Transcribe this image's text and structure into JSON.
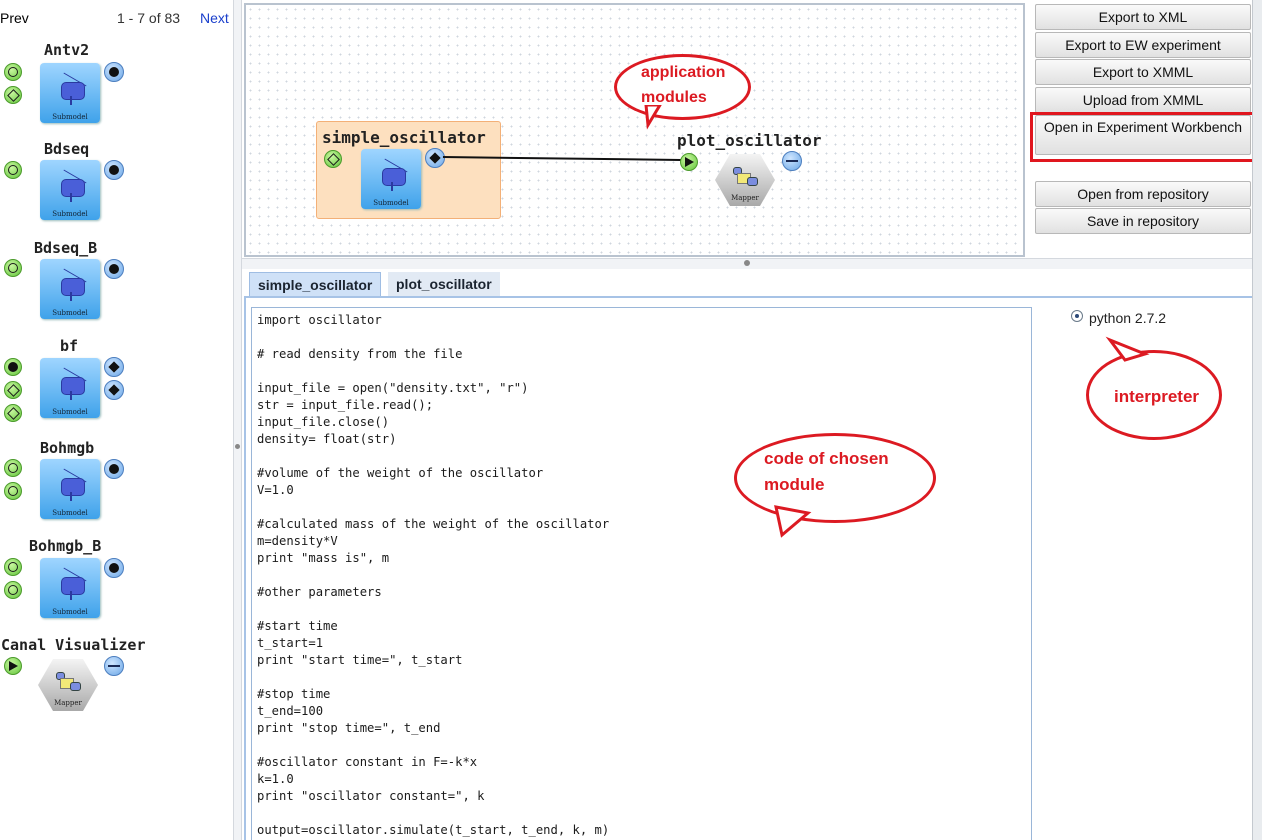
{
  "pager": {
    "prev": "Prev",
    "range": "1 - 7 of 83",
    "next": "Next"
  },
  "palette": {
    "modules": [
      {
        "name": "Antv2",
        "kind": "Submodel"
      },
      {
        "name": "Bdseq",
        "kind": "Submodel"
      },
      {
        "name": "Bdseq_B",
        "kind": "Submodel"
      },
      {
        "name": "bf",
        "kind": "Submodel"
      },
      {
        "name": "Bohmgb",
        "kind": "Submodel"
      },
      {
        "name": "Bohmgb_B",
        "kind": "Submodel"
      },
      {
        "name": "Canal Visualizer",
        "kind": "Mapper"
      }
    ]
  },
  "canvas": {
    "nodes": [
      {
        "name": "simple_oscillator",
        "kind": "Submodel"
      },
      {
        "name": "plot_oscillator",
        "kind": "Mapper"
      }
    ]
  },
  "actions": {
    "export_xml": "Export to XML",
    "export_ew": "Export to EW experiment",
    "export_xmml": "Export to XMML",
    "upload_xmml": "Upload from XMML",
    "open_workbench": "Open in Experiment Workbench",
    "open_repo": "Open from repository",
    "save_repo": "Save in repository"
  },
  "tabs": [
    "simple_oscillator",
    "plot_oscillator"
  ],
  "code": "import oscillator\n\n# read density from the file\n\ninput_file = open(\"density.txt\", \"r\")\nstr = input_file.read();\ninput_file.close()\ndensity= float(str)\n\n#volume of the weight of the oscillator\nV=1.0\n\n#calculated mass of the weight of the oscillator\nm=density*V\nprint \"mass is\", m\n\n#other parameters\n\n#start time\nt_start=1\nprint \"start time=\", t_start\n\n#stop time\nt_end=100\nprint \"stop time=\", t_end\n\n#oscillator constant in F=-k*x\nk=1.0\nprint \"oscillator constant=\", k\n\noutput=oscillator.simulate(t_start, t_end, k, m)",
  "interpreter": {
    "label": "python 2.7.2",
    "selected": true
  },
  "annotations": {
    "app_modules": "application modules",
    "interpreter": "interpreter",
    "code": "code of chosen module"
  },
  "colors": {
    "callout": "#dc1a22",
    "tab_active": "#cfe1f7",
    "submodel": "#3fa2ea",
    "highlight": "#e0161e"
  }
}
